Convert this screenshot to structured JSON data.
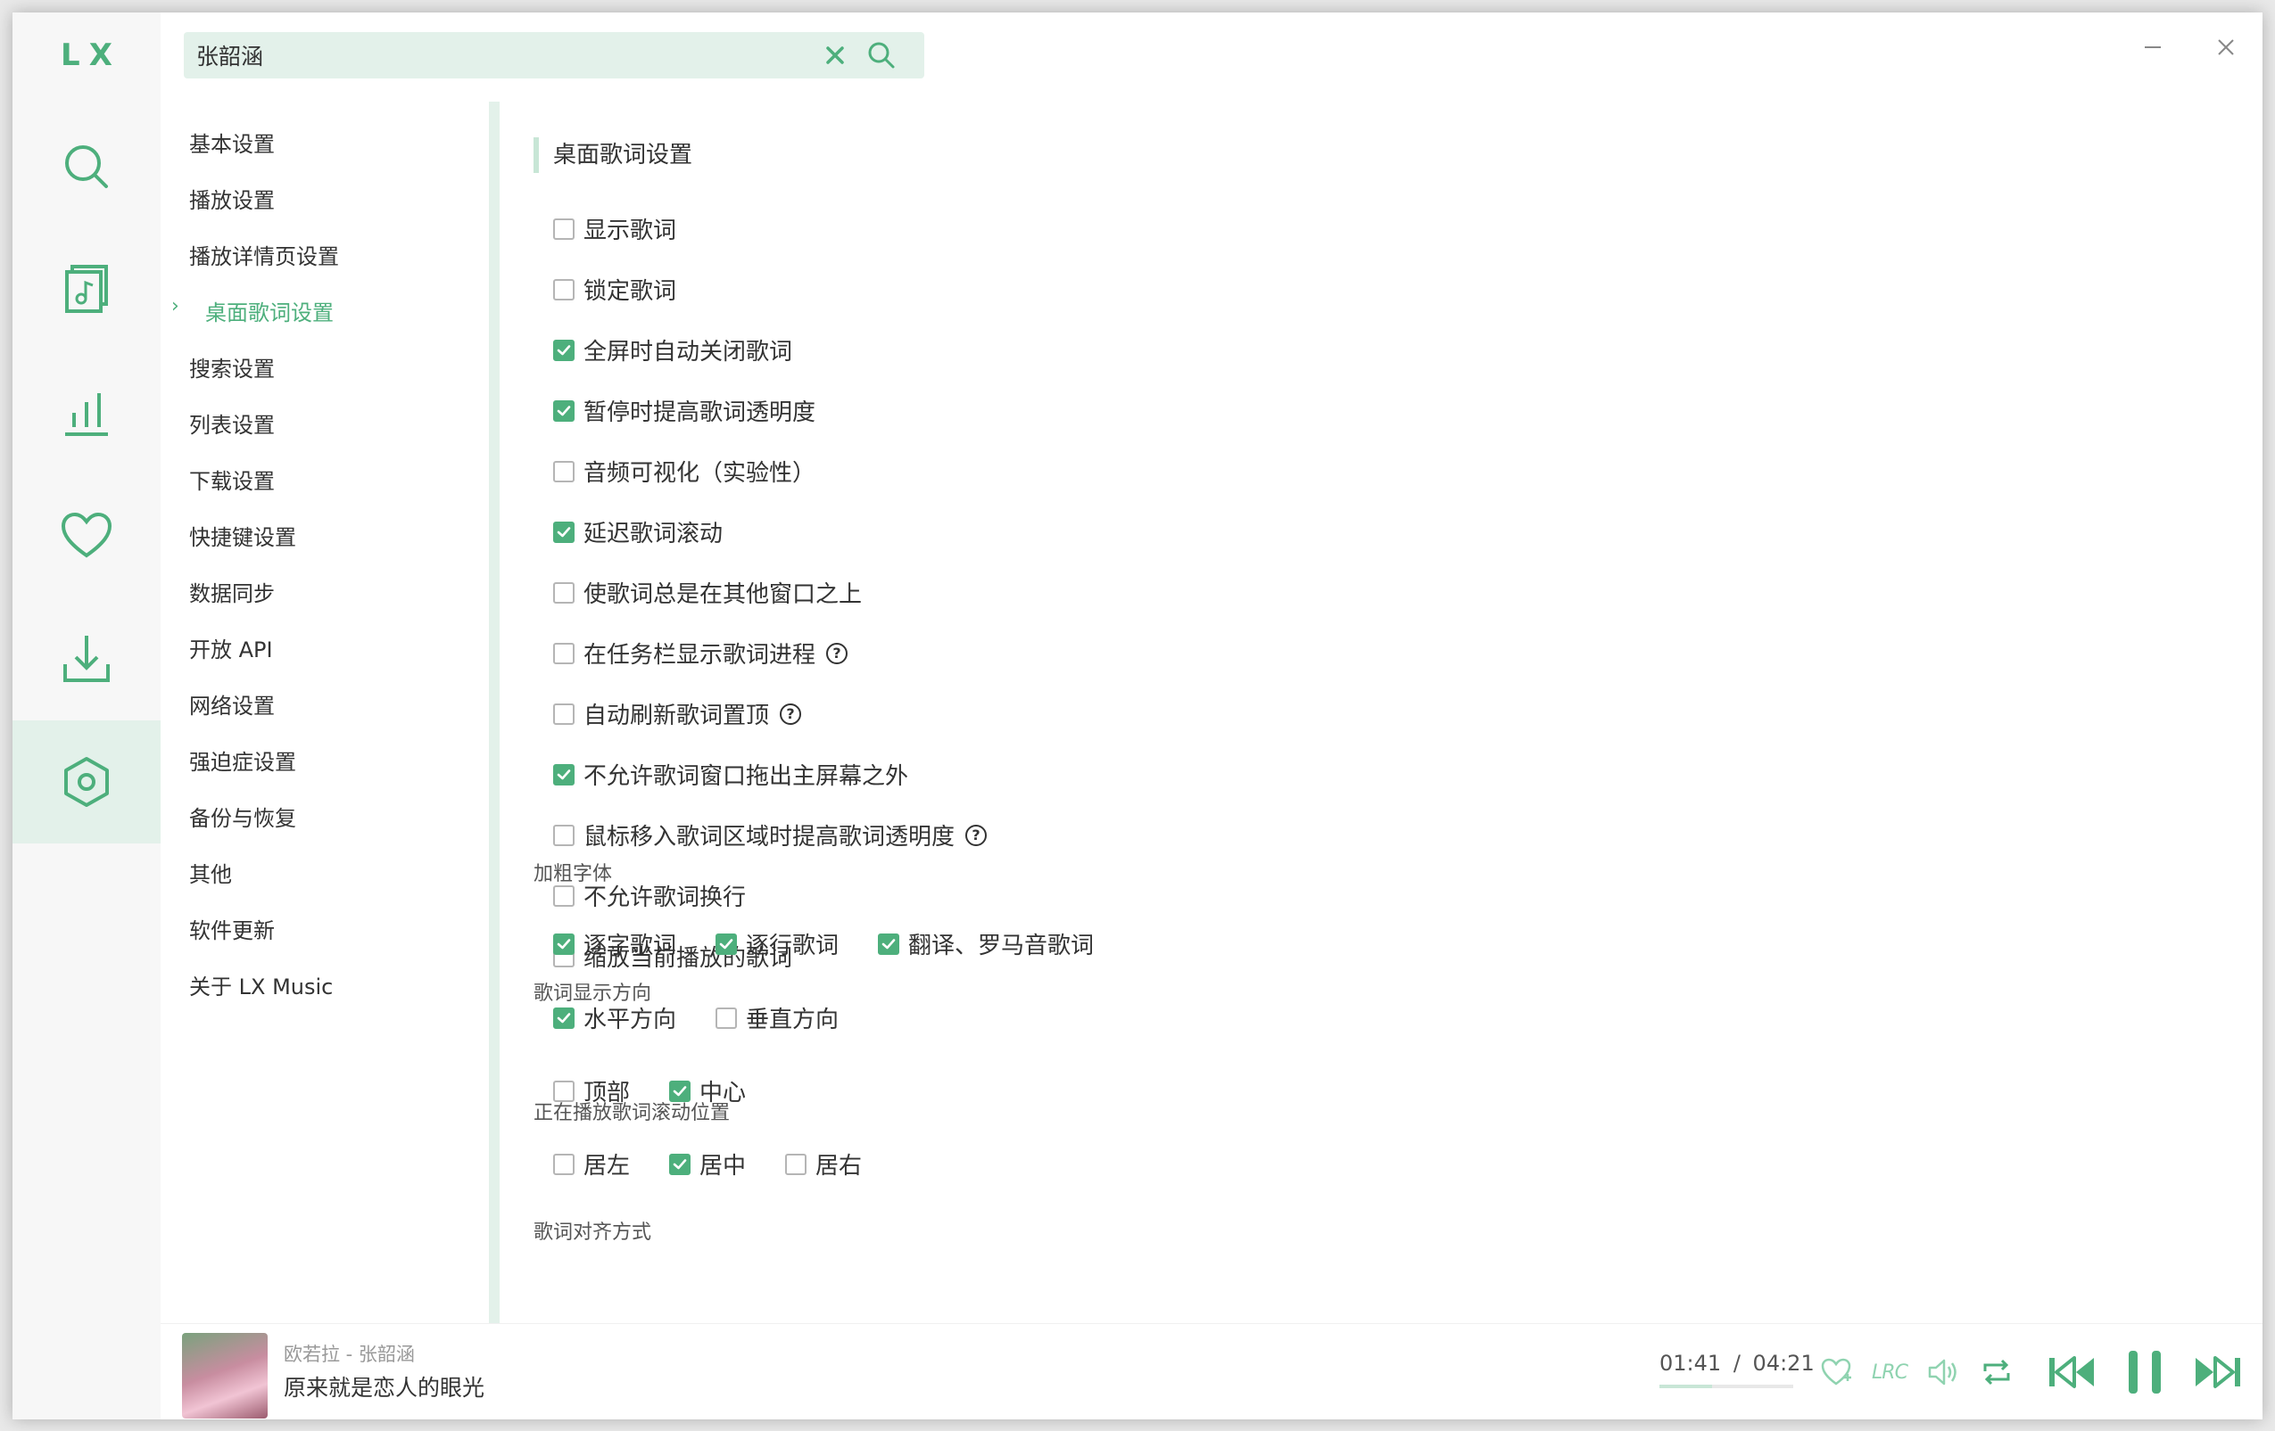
{
  "app": {
    "logo": "LX"
  },
  "colors": {
    "accent": "#4daf7c",
    "accent_light": "#e3f1ea"
  },
  "rail": [
    {
      "name": "search-icon"
    },
    {
      "name": "songlist-icon"
    },
    {
      "name": "leaderboard-icon"
    },
    {
      "name": "heart-icon"
    },
    {
      "name": "download-icon"
    },
    {
      "name": "settings-icon",
      "active": true
    }
  ],
  "search": {
    "value": "张韶涵"
  },
  "nav": {
    "items": [
      "基本设置",
      "播放设置",
      "播放详情页设置",
      "桌面歌词设置",
      "搜索设置",
      "列表设置",
      "下载设置",
      "快捷键设置",
      "数据同步",
      "开放 API",
      "网络设置",
      "强迫症设置",
      "备份与恢复",
      "其他",
      "软件更新",
      "关于 LX Music"
    ],
    "active_index": 3
  },
  "section": {
    "title": "桌面歌词设置",
    "options": [
      {
        "label": "显示歌词",
        "checked": false
      },
      {
        "label": "锁定歌词",
        "checked": false
      },
      {
        "label": "全屏时自动关闭歌词",
        "checked": true
      },
      {
        "label": "暂停时提高歌词透明度",
        "checked": true
      },
      {
        "label": "音频可视化（实验性）",
        "checked": false
      },
      {
        "label": "延迟歌词滚动",
        "checked": true
      },
      {
        "label": "使歌词总是在其他窗口之上",
        "checked": false
      },
      {
        "label": "在任务栏显示歌词进程",
        "checked": false,
        "help": true
      },
      {
        "label": "自动刷新歌词置顶",
        "checked": false,
        "help": true
      },
      {
        "label": "不允许歌词窗口拖出主屏幕之外",
        "checked": true
      },
      {
        "label": "鼠标移入歌词区域时提高歌词透明度",
        "checked": false,
        "help": true
      },
      {
        "label": "不允许歌词换行",
        "checked": false
      },
      {
        "label": "缩放当前播放的歌词",
        "checked": false
      }
    ]
  },
  "groups": [
    {
      "label": "加粗字体",
      "options": [
        {
          "label": "逐字歌词",
          "checked": true
        },
        {
          "label": "逐行歌词",
          "checked": true
        },
        {
          "label": "翻译、罗马音歌词",
          "checked": true
        }
      ]
    },
    {
      "label": "歌词显示方向",
      "options": [
        {
          "label": "水平方向",
          "checked": true
        },
        {
          "label": "垂直方向",
          "checked": false
        }
      ]
    },
    {
      "label": "正在播放歌词滚动位置",
      "options": [
        {
          "label": "顶部",
          "checked": false
        },
        {
          "label": "中心",
          "checked": true
        }
      ]
    },
    {
      "label": "歌词对齐方式",
      "options": [
        {
          "label": "居左",
          "checked": false
        },
        {
          "label": "居中",
          "checked": true
        },
        {
          "label": "居右",
          "checked": false
        }
      ]
    }
  ],
  "player": {
    "artist_line": "欧若拉 - 张韶涵",
    "song": "原来就是恋人的眼光",
    "current_time": "01:41",
    "separator": "/",
    "total_time": "04:21",
    "progress": 0.39,
    "lrc_label": "LRC"
  }
}
